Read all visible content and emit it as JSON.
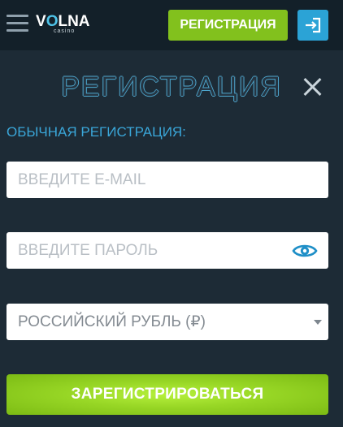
{
  "header": {
    "logo": {
      "brand_start": "V",
      "brand_accent": "O",
      "brand_end": "LNA",
      "sub": "casino"
    },
    "register_label": "РЕГИСТРАЦИЯ"
  },
  "modal": {
    "title": "РЕГИСТРАЦИЯ",
    "section_label": "ОБЫЧНАЯ РЕГИСТРАЦИЯ:",
    "email": {
      "placeholder": "ВВЕДИТЕ E-MAIL",
      "value": ""
    },
    "password": {
      "placeholder": "ВВЕДИТЕ ПАРОЛЬ",
      "value": ""
    },
    "currency": {
      "selected": "РОССИЙСКИЙ РУБЛЬ (₽)"
    },
    "submit_label": "ЗАРЕГИСТРИРОВАТЬСЯ"
  },
  "icons": {
    "menu": "hamburger-menu-icon",
    "login": "login-arrow-icon",
    "close": "close-icon",
    "password_toggle": "eye-icon",
    "dropdown": "chevron-down-icon"
  },
  "colors": {
    "background": "#1d2b36",
    "header_bg": "#132029",
    "accent_green": "#82c11d",
    "accent_blue": "#2ba3d6",
    "label_blue": "#3aa6d8"
  }
}
